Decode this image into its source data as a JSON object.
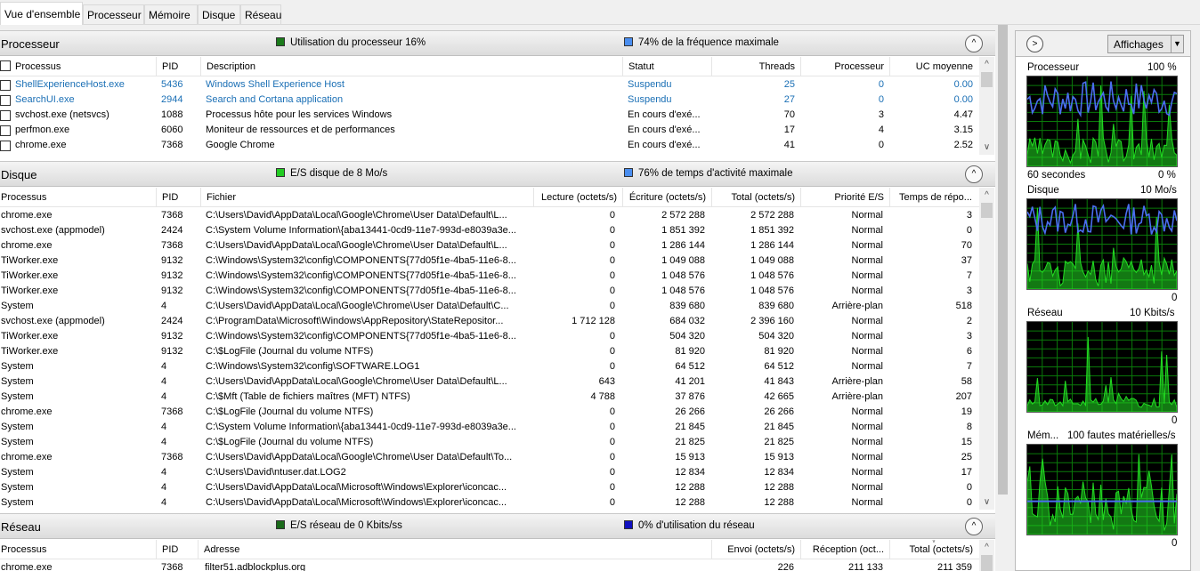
{
  "tabs": [
    {
      "label": "Vue d'ensemble",
      "active": true
    },
    {
      "label": "Processeur",
      "active": false
    },
    {
      "label": "Mémoire",
      "active": false
    },
    {
      "label": "Disque",
      "active": false
    },
    {
      "label": "Réseau",
      "active": false
    }
  ],
  "processeur": {
    "title": "Processeur",
    "indicator1": {
      "text": "Utilisation du processeur 16%",
      "color": "#1a7a1a"
    },
    "indicator2": {
      "text": "74% de la fréquence maximale",
      "color": "#4a8ef0"
    },
    "columns": [
      "Processus",
      "PID",
      "Description",
      "Statut",
      "Threads",
      "Processeur",
      "UC moyenne"
    ],
    "rows": [
      {
        "name": "ShellExperienceHost.exe",
        "pid": "5436",
        "desc": "Windows Shell Experience Host",
        "status": "Suspendu",
        "threads": "25",
        "cpu": "0",
        "avg": "0.00",
        "suspended": true
      },
      {
        "name": "SearchUI.exe",
        "pid": "2944",
        "desc": "Search and Cortana application",
        "status": "Suspendu",
        "threads": "27",
        "cpu": "0",
        "avg": "0.00",
        "suspended": true
      },
      {
        "name": "svchost.exe (netsvcs)",
        "pid": "1088",
        "desc": "Processus hôte pour les services Windows",
        "status": "En cours d'exé...",
        "threads": "70",
        "cpu": "3",
        "avg": "4.47",
        "suspended": false
      },
      {
        "name": "perfmon.exe",
        "pid": "6060",
        "desc": "Moniteur de ressources et de performances",
        "status": "En cours d'exé...",
        "threads": "17",
        "cpu": "4",
        "avg": "3.15",
        "suspended": false
      },
      {
        "name": "chrome.exe",
        "pid": "7368",
        "desc": "Google Chrome",
        "status": "En cours d'exé...",
        "threads": "41",
        "cpu": "0",
        "avg": "2.52",
        "suspended": false
      }
    ]
  },
  "disque": {
    "title": "Disque",
    "indicator1": {
      "text": "E/S disque de 8 Mo/s",
      "color": "#22cc22"
    },
    "indicator2": {
      "text": "76% de temps d'activité maximale",
      "color": "#4a8ef0"
    },
    "columns": [
      "Processus",
      "PID",
      "Fichier",
      "Lecture (octets/s)",
      "Écriture (octets/s)",
      "Total (octets/s)",
      "Priorité E/S",
      "Temps de répo..."
    ],
    "rows": [
      [
        "chrome.exe",
        "7368",
        "C:\\Users\\David\\AppData\\Local\\Google\\Chrome\\User Data\\Default\\L...",
        "0",
        "2 572 288",
        "2 572 288",
        "Normal",
        "3"
      ],
      [
        "svchost.exe (appmodel)",
        "2424",
        "C:\\System Volume Information\\{aba13441-0cd9-11e7-993d-e8039a3e...",
        "0",
        "1 851 392",
        "1 851 392",
        "Normal",
        "0"
      ],
      [
        "chrome.exe",
        "7368",
        "C:\\Users\\David\\AppData\\Local\\Google\\Chrome\\User Data\\Default\\L...",
        "0",
        "1 286 144",
        "1 286 144",
        "Normal",
        "70"
      ],
      [
        "TiWorker.exe",
        "9132",
        "C:\\Windows\\System32\\config\\COMPONENTS{77d05f1e-4ba5-11e6-8...",
        "0",
        "1 049 088",
        "1 049 088",
        "Normal",
        "37"
      ],
      [
        "TiWorker.exe",
        "9132",
        "C:\\Windows\\System32\\config\\COMPONENTS{77d05f1e-4ba5-11e6-8...",
        "0",
        "1 048 576",
        "1 048 576",
        "Normal",
        "7"
      ],
      [
        "TiWorker.exe",
        "9132",
        "C:\\Windows\\System32\\config\\COMPONENTS{77d05f1e-4ba5-11e6-8...",
        "0",
        "1 048 576",
        "1 048 576",
        "Normal",
        "3"
      ],
      [
        "System",
        "4",
        "C:\\Users\\David\\AppData\\Local\\Google\\Chrome\\User Data\\Default\\C...",
        "0",
        "839 680",
        "839 680",
        "Arrière-plan",
        "518"
      ],
      [
        "svchost.exe (appmodel)",
        "2424",
        "C:\\ProgramData\\Microsoft\\Windows\\AppRepository\\StateRepositor...",
        "1 712 128",
        "684 032",
        "2 396 160",
        "Normal",
        "2"
      ],
      [
        "TiWorker.exe",
        "9132",
        "C:\\Windows\\System32\\config\\COMPONENTS{77d05f1e-4ba5-11e6-8...",
        "0",
        "504 320",
        "504 320",
        "Normal",
        "3"
      ],
      [
        "TiWorker.exe",
        "9132",
        "C:\\$LogFile (Journal du volume NTFS)",
        "0",
        "81 920",
        "81 920",
        "Normal",
        "6"
      ],
      [
        "System",
        "4",
        "C:\\Windows\\System32\\config\\SOFTWARE.LOG1",
        "0",
        "64 512",
        "64 512",
        "Normal",
        "7"
      ],
      [
        "System",
        "4",
        "C:\\Users\\David\\AppData\\Local\\Google\\Chrome\\User Data\\Default\\L...",
        "643",
        "41 201",
        "41 843",
        "Arrière-plan",
        "58"
      ],
      [
        "System",
        "4",
        "C:\\$Mft (Table de fichiers maîtres (MFT) NTFS)",
        "4 788",
        "37 876",
        "42 665",
        "Arrière-plan",
        "207"
      ],
      [
        "chrome.exe",
        "7368",
        "C:\\$LogFile (Journal du volume NTFS)",
        "0",
        "26 266",
        "26 266",
        "Normal",
        "19"
      ],
      [
        "System",
        "4",
        "C:\\System Volume Information\\{aba13441-0cd9-11e7-993d-e8039a3e...",
        "0",
        "21 845",
        "21 845",
        "Normal",
        "8"
      ],
      [
        "System",
        "4",
        "C:\\$LogFile (Journal du volume NTFS)",
        "0",
        "21 825",
        "21 825",
        "Normal",
        "15"
      ],
      [
        "chrome.exe",
        "7368",
        "C:\\Users\\David\\AppData\\Local\\Google\\Chrome\\User Data\\Default\\To...",
        "0",
        "15 913",
        "15 913",
        "Normal",
        "25"
      ],
      [
        "System",
        "4",
        "C:\\Users\\David\\ntuser.dat.LOG2",
        "0",
        "12 834",
        "12 834",
        "Normal",
        "17"
      ],
      [
        "System",
        "4",
        "C:\\Users\\David\\AppData\\Local\\Microsoft\\Windows\\Explorer\\iconcac...",
        "0",
        "12 288",
        "12 288",
        "Normal",
        "0"
      ],
      [
        "System",
        "4",
        "C:\\Users\\David\\AppData\\Local\\Microsoft\\Windows\\Explorer\\iconcac...",
        "0",
        "12 288",
        "12 288",
        "Normal",
        "0"
      ]
    ]
  },
  "reseau": {
    "title": "Réseau",
    "indicator1": {
      "text": "E/S réseau de 0 Kbits/ss",
      "color": "#1a6a1a"
    },
    "indicator2": {
      "text": "0% d'utilisation du réseau",
      "color": "#1010c0"
    },
    "columns": [
      "Processus",
      "PID",
      "Adresse",
      "Envoi (octets/s)",
      "Réception (oct...",
      "Total (octets/s)"
    ],
    "rows": [
      [
        "chrome.exe",
        "7368",
        "filter51.adblockplus.org",
        "226",
        "211 133",
        "211 359"
      ]
    ]
  },
  "right_panel": {
    "view_button": "Affichages",
    "graphs": [
      {
        "name": "Processeur",
        "max": "100 %",
        "left_bottom": "60 secondes",
        "right_bottom": "0 %"
      },
      {
        "name": "Disque",
        "max": "10 Mo/s",
        "left_bottom": "",
        "right_bottom": "0"
      },
      {
        "name": "Réseau",
        "max": "10 Kbits/s",
        "left_bottom": "",
        "right_bottom": "0"
      },
      {
        "name": "Mém...",
        "max": "100 fautes matérielles/s",
        "left_bottom": "",
        "right_bottom": "0"
      }
    ]
  },
  "colors": {
    "graph_green": "#22dd22",
    "graph_blue": "#4a6ef0",
    "grid_green": "#0a7a0a",
    "suspended_text": "#1a6fb5"
  }
}
